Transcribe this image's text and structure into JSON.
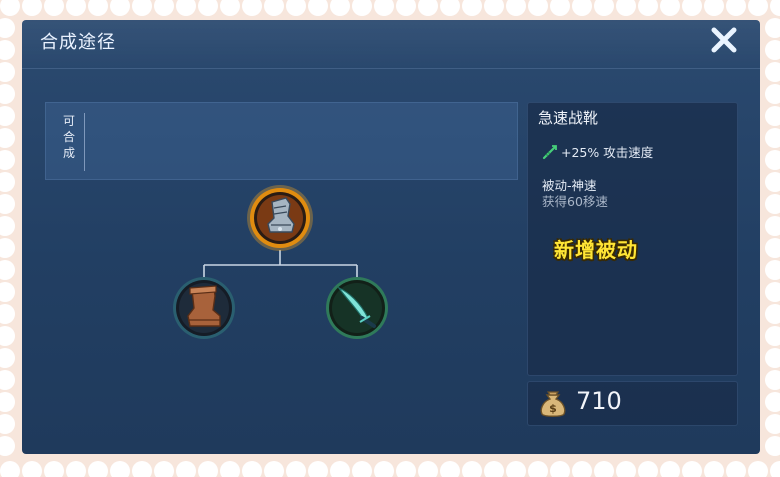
{
  "window": {
    "title": "合成途径"
  },
  "recipe": {
    "label_chars": [
      "可",
      "合",
      "成"
    ]
  },
  "tree": {
    "root": {
      "name": "急速战靴",
      "icon": "armored-boot-icon"
    },
    "children": [
      {
        "name": "leather-boots",
        "icon": "leather-boot-icon"
      },
      {
        "name": "dagger",
        "icon": "dagger-icon"
      }
    ]
  },
  "item": {
    "name": "急速战靴",
    "stat": "+25% 攻击速度",
    "passive_name": "被动-神速",
    "passive_desc": "获得60移速",
    "overlay_note": "新增被动",
    "price": "710"
  },
  "colors": {
    "panel": "#223f63",
    "accent_gold": "#f2a41f",
    "overlay_yellow": "#ffe535",
    "frame": "#f7e6dc"
  }
}
